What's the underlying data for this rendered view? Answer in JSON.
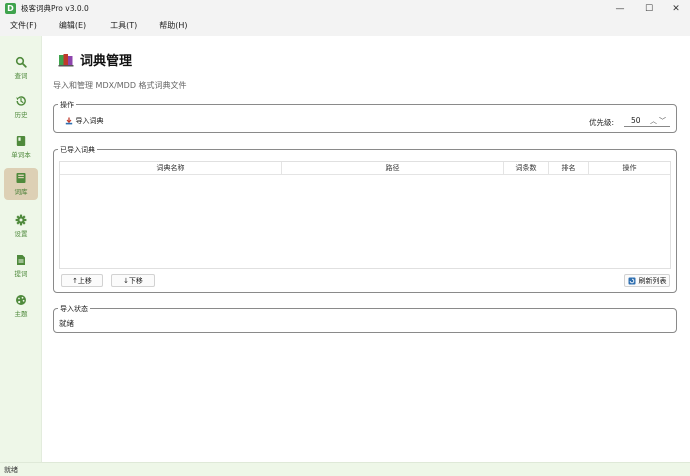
{
  "window": {
    "title": "极客词典Pro v3.0.0",
    "app_icon_glyph": "D",
    "controls": [
      "—",
      "☐",
      "✕"
    ]
  },
  "menu": [
    "文件(F)",
    "编辑(E)",
    "工具(T)",
    "帮助(H)"
  ],
  "sidebar": {
    "accent": "#4f8a3c",
    "items": [
      {
        "label": "查词",
        "icon": "search-icon"
      },
      {
        "label": "历史",
        "icon": "history-icon"
      },
      {
        "label": "单词本",
        "icon": "book-icon"
      },
      {
        "label": "词库",
        "icon": "library-icon",
        "active": true
      },
      {
        "label": "设置",
        "icon": "gear-icon"
      },
      {
        "label": "提词",
        "icon": "document-icon"
      },
      {
        "label": "主题",
        "icon": "palette-icon"
      }
    ]
  },
  "page": {
    "title": "词典管理",
    "subtitle": "导入和管理 MDX/MDD 格式词典文件"
  },
  "operation": {
    "legend": "操作",
    "import_button": "导入词典",
    "priority_label": "优先级:",
    "priority_value": "50",
    "spin_arrows": "︿﹀"
  },
  "imported": {
    "legend": "已导入词典",
    "columns": [
      "词典名称",
      "路径",
      "词条数",
      "排名",
      "操作"
    ],
    "rows": [],
    "move_up": "↑上移",
    "move_down": "↓下移",
    "refresh": "刷新列表"
  },
  "import_status": {
    "legend": "导入状态",
    "text": "就绪"
  },
  "statusbar": {
    "text": "就绪"
  }
}
